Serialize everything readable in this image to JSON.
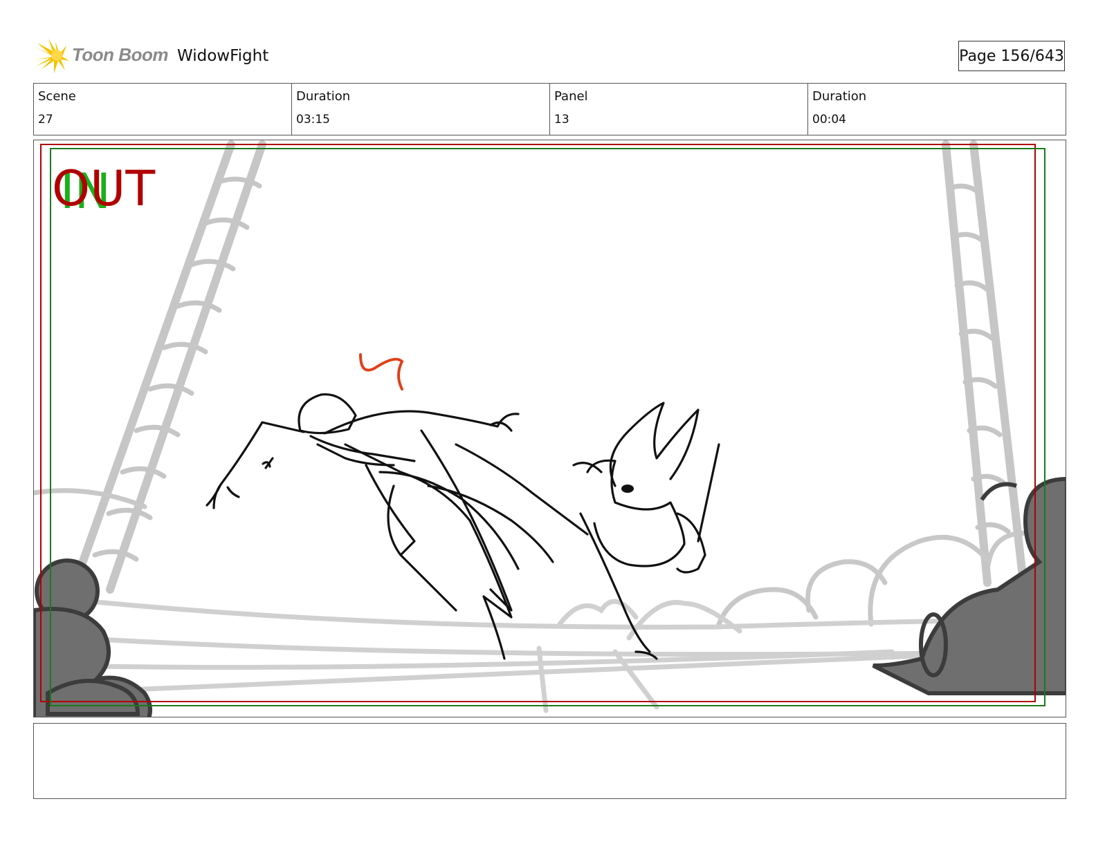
{
  "header": {
    "logo_text": "Toon Boom",
    "project_title": "WidowFight",
    "page_label": "Page 156/643"
  },
  "info": {
    "scene_label": "Scene",
    "scene_value": "27",
    "scene_duration_label": "Duration",
    "scene_duration_value": "03:15",
    "panel_label": "Panel",
    "panel_value": "13",
    "panel_duration_label": "Duration",
    "panel_duration_value": "00:04"
  },
  "panel": {
    "in_marker": "IN",
    "out_marker": "OUT",
    "colors": {
      "safe_frame_red": "#b00000",
      "safe_frame_green": "#1a7a1a",
      "sketch_gray": "#c4c4c4",
      "rock_gray": "#6e6e6e",
      "accent_red": "#e0401a"
    }
  },
  "notes": {
    "text": ""
  }
}
